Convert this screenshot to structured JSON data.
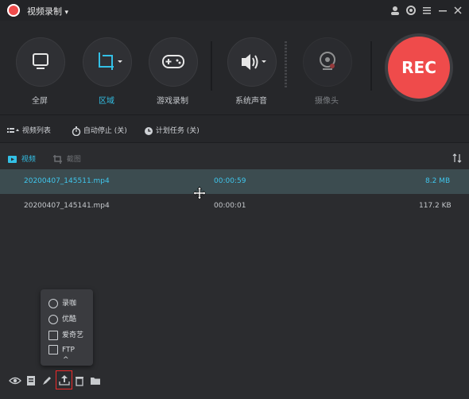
{
  "app": {
    "title": "视频录制",
    "dropdown_glyph": "▾"
  },
  "toolbar": {
    "tools": [
      {
        "label": "全屏"
      },
      {
        "label": "区域"
      },
      {
        "label": "游戏录制"
      },
      {
        "label": "系统声音"
      },
      {
        "label": "摄像头"
      }
    ],
    "rec_label": "REC"
  },
  "statusbar": {
    "video_list": "视频列表",
    "auto_stop": "自动停止 (关)",
    "schedule": "计划任务 (关)"
  },
  "tabs": {
    "video": "视频",
    "screenshot": "截图"
  },
  "files": [
    {
      "name": "20200407_145511.mp4",
      "duration": "00:00:59",
      "size": "8.2 MB",
      "selected": true
    },
    {
      "name": "20200407_145141.mp4",
      "duration": "00:00:01",
      "size": "117.2 KB",
      "selected": false
    }
  ],
  "upload_menu": {
    "items": [
      {
        "label": "录咖"
      },
      {
        "label": "优酷"
      },
      {
        "label": "爱奇艺"
      },
      {
        "label": "FTP"
      }
    ],
    "collapse_glyph": "^"
  },
  "colors": {
    "accent": "#33c0e6",
    "rec": "#ef4b4b",
    "highlight": "#ef2a2a"
  }
}
